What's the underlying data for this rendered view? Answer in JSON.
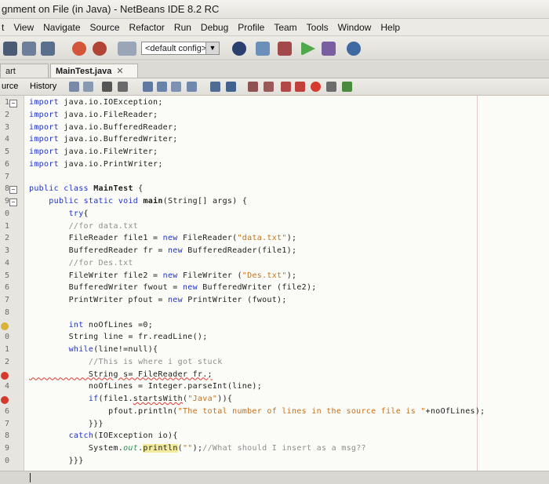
{
  "window": {
    "title": "gnment on File (in Java) - NetBeans IDE 8.2 RC"
  },
  "menu": [
    "t",
    "View",
    "Navigate",
    "Source",
    "Refactor",
    "Run",
    "Debug",
    "Profile",
    "Team",
    "Tools",
    "Window",
    "Help"
  ],
  "toolbar": {
    "config_value": "<default config>"
  },
  "tabs": [
    {
      "label": "art Page",
      "active": false
    },
    {
      "label": "MainTest.java",
      "active": true
    }
  ],
  "editor_toolbar": {
    "source_label": "urce",
    "history_label": "History"
  },
  "gutter": {
    "line_numbers": [
      "1",
      "2",
      "3",
      "4",
      "5",
      "6",
      "7",
      "8",
      "9",
      "0",
      "1",
      "2",
      "3",
      "4",
      "5",
      "6",
      "7",
      "8",
      "",
      "0",
      "1",
      "2",
      "",
      "4",
      "",
      "6",
      "7",
      "8",
      "9",
      "0"
    ]
  },
  "code_lines": [
    "import java.io.IOException;",
    "import java.io.FileReader;",
    "import java.io.BufferedReader;",
    "import java.io.BufferedWriter;",
    "import java.io.FileWriter;",
    "import java.io.PrintWriter;",
    "",
    "public class MainTest {",
    "    public static void main(String[] args) {",
    "        try{",
    "        //for data.txt",
    "        FileReader file1 = new FileReader(\"data.txt\");",
    "        BufferedReader fr = new BufferedReader(file1);",
    "        //for Des.txt",
    "        FileWriter file2 = new FileWriter (\"Des.txt\");",
    "        BufferedWriter fwout = new BufferedWriter (file2);",
    "        PrintWriter pfout = new PrintWriter (fwout);",
    "",
    "        int noOfLines =0;",
    "        String line = fr.readLine();",
    "        while(line!=null){",
    "            //This is where i got stuck",
    "            String s= FileReader fr.;",
    "            noOfLines = Integer.parseInt(line);",
    "            if(file1.startsWith(\"Java\")){",
    "                pfout.println(\"The total number of lines in the source file is \"+noOfLines);",
    "            }}}",
    "        catch(IOException io){",
    "            System.out.println(\"\");//What should I insert as a msg??",
    "        }}}"
  ],
  "colors": {
    "keyword": "#1f33c9",
    "string": "#c4711c",
    "comment": "#8e8e8e",
    "error": "#d63a2e",
    "highlight": "#f2ea9c"
  }
}
